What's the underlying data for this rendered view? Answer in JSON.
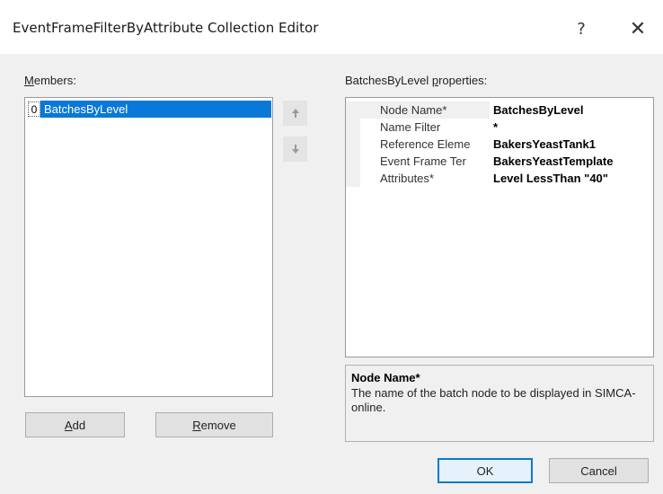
{
  "window": {
    "title": "EventFrameFilterByAttribute Collection Editor",
    "help_glyph": "?",
    "close_glyph": "✕"
  },
  "members": {
    "label_underlined": "M",
    "label_rest": "embers:",
    "items": [
      {
        "index": "0",
        "label": "BatchesByLevel",
        "selected": true
      }
    ]
  },
  "move_buttons": {
    "up_icon": "arrow-up-icon",
    "down_icon": "arrow-down-icon"
  },
  "buttons": {
    "add_u": "A",
    "add_rest": "dd",
    "remove_u": "R",
    "remove_rest": "emove",
    "ok": "OK",
    "cancel": "Cancel"
  },
  "properties": {
    "label_pre": "BatchesByLevel ",
    "label_u": "p",
    "label_post": "roperties:",
    "rows": [
      {
        "name": "Node Name*",
        "value": "BatchesByLevel"
      },
      {
        "name": "Name Filter",
        "value": "*"
      },
      {
        "name": "Reference Eleme",
        "value": "BakersYeastTank1"
      },
      {
        "name": "Event Frame Ter",
        "value": "BakersYeastTemplate"
      },
      {
        "name": "Attributes*",
        "value": "Level LessThan \"40\""
      }
    ]
  },
  "description": {
    "title": "Node Name*",
    "text": "The name of the batch node to be displayed in SIMCA-online."
  },
  "colors": {
    "selection": "#0a78d7",
    "accent": "#0a78d7"
  }
}
